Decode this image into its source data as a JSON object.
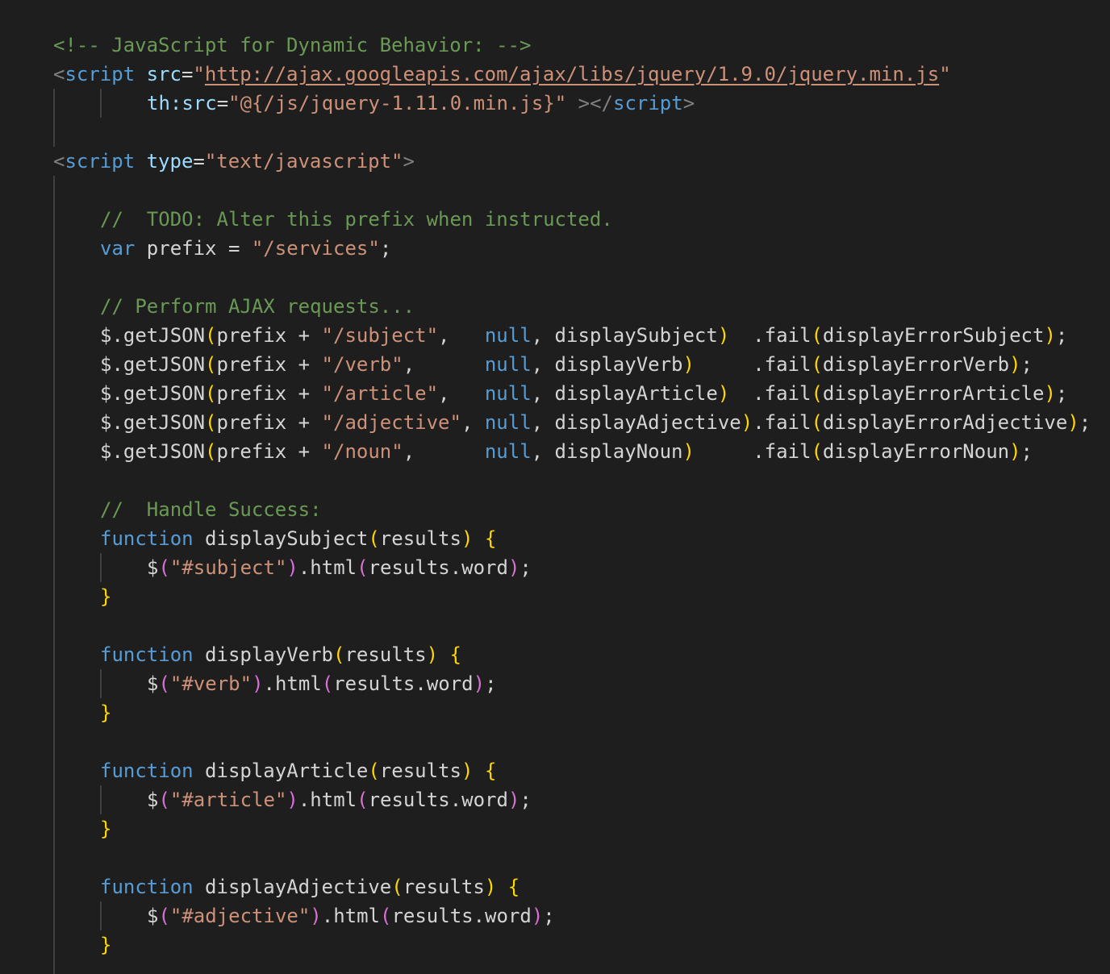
{
  "editor": {
    "theme": {
      "background": "#1e1e1e",
      "comment": "#6a9955",
      "tag": "#569cd6",
      "attribute": "#9cdcfe",
      "string": "#ce9178",
      "keyword": "#569cd6",
      "text": "#d4d4d4",
      "bracket_level_1": "#ffd700",
      "bracket_level_2": "#da70d6",
      "tag_bracket": "#808080"
    },
    "lines": [
      {
        "indent": 0,
        "tokens": [
          [
            "comment",
            "<!-- JavaScript for Dynamic Behavior: -->"
          ]
        ]
      },
      {
        "indent": 0,
        "tokens": [
          [
            "tag-bracket",
            "<"
          ],
          [
            "tag",
            "script"
          ],
          [
            "punct",
            " "
          ],
          [
            "attr",
            "src"
          ],
          [
            "punct",
            "="
          ],
          [
            "string",
            "\""
          ],
          [
            "link",
            "http://ajax.googleapis.com/ajax/libs/jquery/1.9.0/jquery.min.js"
          ],
          [
            "string",
            "\""
          ]
        ]
      },
      {
        "indent": 8,
        "tokens": [
          [
            "attr",
            "th:src"
          ],
          [
            "punct",
            "="
          ],
          [
            "string",
            "\"@{/js/jquery-1.11.0.min.js}\""
          ],
          [
            "punct",
            " "
          ],
          [
            "tag-bracket",
            "></"
          ],
          [
            "tag",
            "script"
          ],
          [
            "tag-bracket",
            ">"
          ]
        ]
      },
      {
        "indent": 0,
        "tokens": []
      },
      {
        "indent": 0,
        "tokens": [
          [
            "tag-bracket",
            "<"
          ],
          [
            "tag",
            "script"
          ],
          [
            "punct",
            " "
          ],
          [
            "attr",
            "type"
          ],
          [
            "punct",
            "="
          ],
          [
            "string",
            "\"text/javascript\""
          ],
          [
            "tag-bracket",
            ">"
          ]
        ]
      },
      {
        "indent": 0,
        "tokens": []
      },
      {
        "indent": 4,
        "tokens": [
          [
            "comment",
            "//  TODO: Alter this prefix when instructed."
          ]
        ]
      },
      {
        "indent": 4,
        "tokens": [
          [
            "keyword",
            "var"
          ],
          [
            "ident",
            " prefix = "
          ],
          [
            "string",
            "\"/services\""
          ],
          [
            "punct",
            ";"
          ]
        ]
      },
      {
        "indent": 0,
        "tokens": []
      },
      {
        "indent": 4,
        "tokens": [
          [
            "comment",
            "// Perform AJAX requests..."
          ]
        ]
      },
      {
        "indent": 4,
        "tokens": [
          [
            "ident",
            "$.getJSON"
          ],
          [
            "paren1",
            "("
          ],
          [
            "ident",
            "prefix + "
          ],
          [
            "string",
            "\"/subject\""
          ],
          [
            "punct",
            ",   "
          ],
          [
            "keyword",
            "null"
          ],
          [
            "punct",
            ", displaySubject"
          ],
          [
            "paren1",
            ")"
          ],
          [
            "punct",
            "  .fail"
          ],
          [
            "paren1",
            "("
          ],
          [
            "ident",
            "displayErrorSubject"
          ],
          [
            "paren1",
            ")"
          ],
          [
            "punct",
            ";"
          ]
        ]
      },
      {
        "indent": 4,
        "tokens": [
          [
            "ident",
            "$.getJSON"
          ],
          [
            "paren1",
            "("
          ],
          [
            "ident",
            "prefix + "
          ],
          [
            "string",
            "\"/verb\""
          ],
          [
            "punct",
            ",      "
          ],
          [
            "keyword",
            "null"
          ],
          [
            "punct",
            ", displayVerb"
          ],
          [
            "paren1",
            ")"
          ],
          [
            "punct",
            "     .fail"
          ],
          [
            "paren1",
            "("
          ],
          [
            "ident",
            "displayErrorVerb"
          ],
          [
            "paren1",
            ")"
          ],
          [
            "punct",
            ";"
          ]
        ]
      },
      {
        "indent": 4,
        "tokens": [
          [
            "ident",
            "$.getJSON"
          ],
          [
            "paren1",
            "("
          ],
          [
            "ident",
            "prefix + "
          ],
          [
            "string",
            "\"/article\""
          ],
          [
            "punct",
            ",   "
          ],
          [
            "keyword",
            "null"
          ],
          [
            "punct",
            ", displayArticle"
          ],
          [
            "paren1",
            ")"
          ],
          [
            "punct",
            "  .fail"
          ],
          [
            "paren1",
            "("
          ],
          [
            "ident",
            "displayErrorArticle"
          ],
          [
            "paren1",
            ")"
          ],
          [
            "punct",
            ";"
          ]
        ]
      },
      {
        "indent": 4,
        "tokens": [
          [
            "ident",
            "$.getJSON"
          ],
          [
            "paren1",
            "("
          ],
          [
            "ident",
            "prefix + "
          ],
          [
            "string",
            "\"/adjective\""
          ],
          [
            "punct",
            ", "
          ],
          [
            "keyword",
            "null"
          ],
          [
            "punct",
            ", displayAdjective"
          ],
          [
            "paren1",
            ")"
          ],
          [
            "punct",
            ".fail"
          ],
          [
            "paren1",
            "("
          ],
          [
            "ident",
            "displayErrorAdjective"
          ],
          [
            "paren1",
            ")"
          ],
          [
            "punct",
            ";"
          ]
        ]
      },
      {
        "indent": 4,
        "tokens": [
          [
            "ident",
            "$.getJSON"
          ],
          [
            "paren1",
            "("
          ],
          [
            "ident",
            "prefix + "
          ],
          [
            "string",
            "\"/noun\""
          ],
          [
            "punct",
            ",      "
          ],
          [
            "keyword",
            "null"
          ],
          [
            "punct",
            ", displayNoun"
          ],
          [
            "paren1",
            ")"
          ],
          [
            "punct",
            "     .fail"
          ],
          [
            "paren1",
            "("
          ],
          [
            "ident",
            "displayErrorNoun"
          ],
          [
            "paren1",
            ")"
          ],
          [
            "punct",
            ";"
          ]
        ]
      },
      {
        "indent": 0,
        "tokens": []
      },
      {
        "indent": 4,
        "tokens": [
          [
            "comment",
            "//  Handle Success:"
          ]
        ]
      },
      {
        "indent": 4,
        "tokens": [
          [
            "keyword",
            "function"
          ],
          [
            "ident",
            " displaySubject"
          ],
          [
            "paren1",
            "("
          ],
          [
            "ident",
            "results"
          ],
          [
            "paren1",
            ")"
          ],
          [
            "punct",
            " "
          ],
          [
            "paren1",
            "{"
          ]
        ]
      },
      {
        "indent": 8,
        "tokens": [
          [
            "ident",
            "$"
          ],
          [
            "paren2",
            "("
          ],
          [
            "string",
            "\"#subject\""
          ],
          [
            "paren2",
            ")"
          ],
          [
            "ident",
            ".html"
          ],
          [
            "paren2",
            "("
          ],
          [
            "ident",
            "results.word"
          ],
          [
            "paren2",
            ")"
          ],
          [
            "punct",
            ";"
          ]
        ]
      },
      {
        "indent": 4,
        "tokens": [
          [
            "paren1",
            "}"
          ]
        ]
      },
      {
        "indent": 0,
        "tokens": []
      },
      {
        "indent": 4,
        "tokens": [
          [
            "keyword",
            "function"
          ],
          [
            "ident",
            " displayVerb"
          ],
          [
            "paren1",
            "("
          ],
          [
            "ident",
            "results"
          ],
          [
            "paren1",
            ")"
          ],
          [
            "punct",
            " "
          ],
          [
            "paren1",
            "{"
          ]
        ]
      },
      {
        "indent": 8,
        "tokens": [
          [
            "ident",
            "$"
          ],
          [
            "paren2",
            "("
          ],
          [
            "string",
            "\"#verb\""
          ],
          [
            "paren2",
            ")"
          ],
          [
            "ident",
            ".html"
          ],
          [
            "paren2",
            "("
          ],
          [
            "ident",
            "results.word"
          ],
          [
            "paren2",
            ")"
          ],
          [
            "punct",
            ";"
          ]
        ]
      },
      {
        "indent": 4,
        "tokens": [
          [
            "paren1",
            "}"
          ]
        ]
      },
      {
        "indent": 0,
        "tokens": []
      },
      {
        "indent": 4,
        "tokens": [
          [
            "keyword",
            "function"
          ],
          [
            "ident",
            " displayArticle"
          ],
          [
            "paren1",
            "("
          ],
          [
            "ident",
            "results"
          ],
          [
            "paren1",
            ")"
          ],
          [
            "punct",
            " "
          ],
          [
            "paren1",
            "{"
          ]
        ]
      },
      {
        "indent": 8,
        "tokens": [
          [
            "ident",
            "$"
          ],
          [
            "paren2",
            "("
          ],
          [
            "string",
            "\"#article\""
          ],
          [
            "paren2",
            ")"
          ],
          [
            "ident",
            ".html"
          ],
          [
            "paren2",
            "("
          ],
          [
            "ident",
            "results.word"
          ],
          [
            "paren2",
            ")"
          ],
          [
            "punct",
            ";"
          ]
        ]
      },
      {
        "indent": 4,
        "tokens": [
          [
            "paren1",
            "}"
          ]
        ]
      },
      {
        "indent": 0,
        "tokens": []
      },
      {
        "indent": 4,
        "tokens": [
          [
            "keyword",
            "function"
          ],
          [
            "ident",
            " displayAdjective"
          ],
          [
            "paren1",
            "("
          ],
          [
            "ident",
            "results"
          ],
          [
            "paren1",
            ")"
          ],
          [
            "punct",
            " "
          ],
          [
            "paren1",
            "{"
          ]
        ]
      },
      {
        "indent": 8,
        "tokens": [
          [
            "ident",
            "$"
          ],
          [
            "paren2",
            "("
          ],
          [
            "string",
            "\"#adjective\""
          ],
          [
            "paren2",
            ")"
          ],
          [
            "ident",
            ".html"
          ],
          [
            "paren2",
            "("
          ],
          [
            "ident",
            "results.word"
          ],
          [
            "paren2",
            ")"
          ],
          [
            "punct",
            ";"
          ]
        ]
      },
      {
        "indent": 4,
        "tokens": [
          [
            "paren1",
            "}"
          ]
        ]
      }
    ]
  }
}
